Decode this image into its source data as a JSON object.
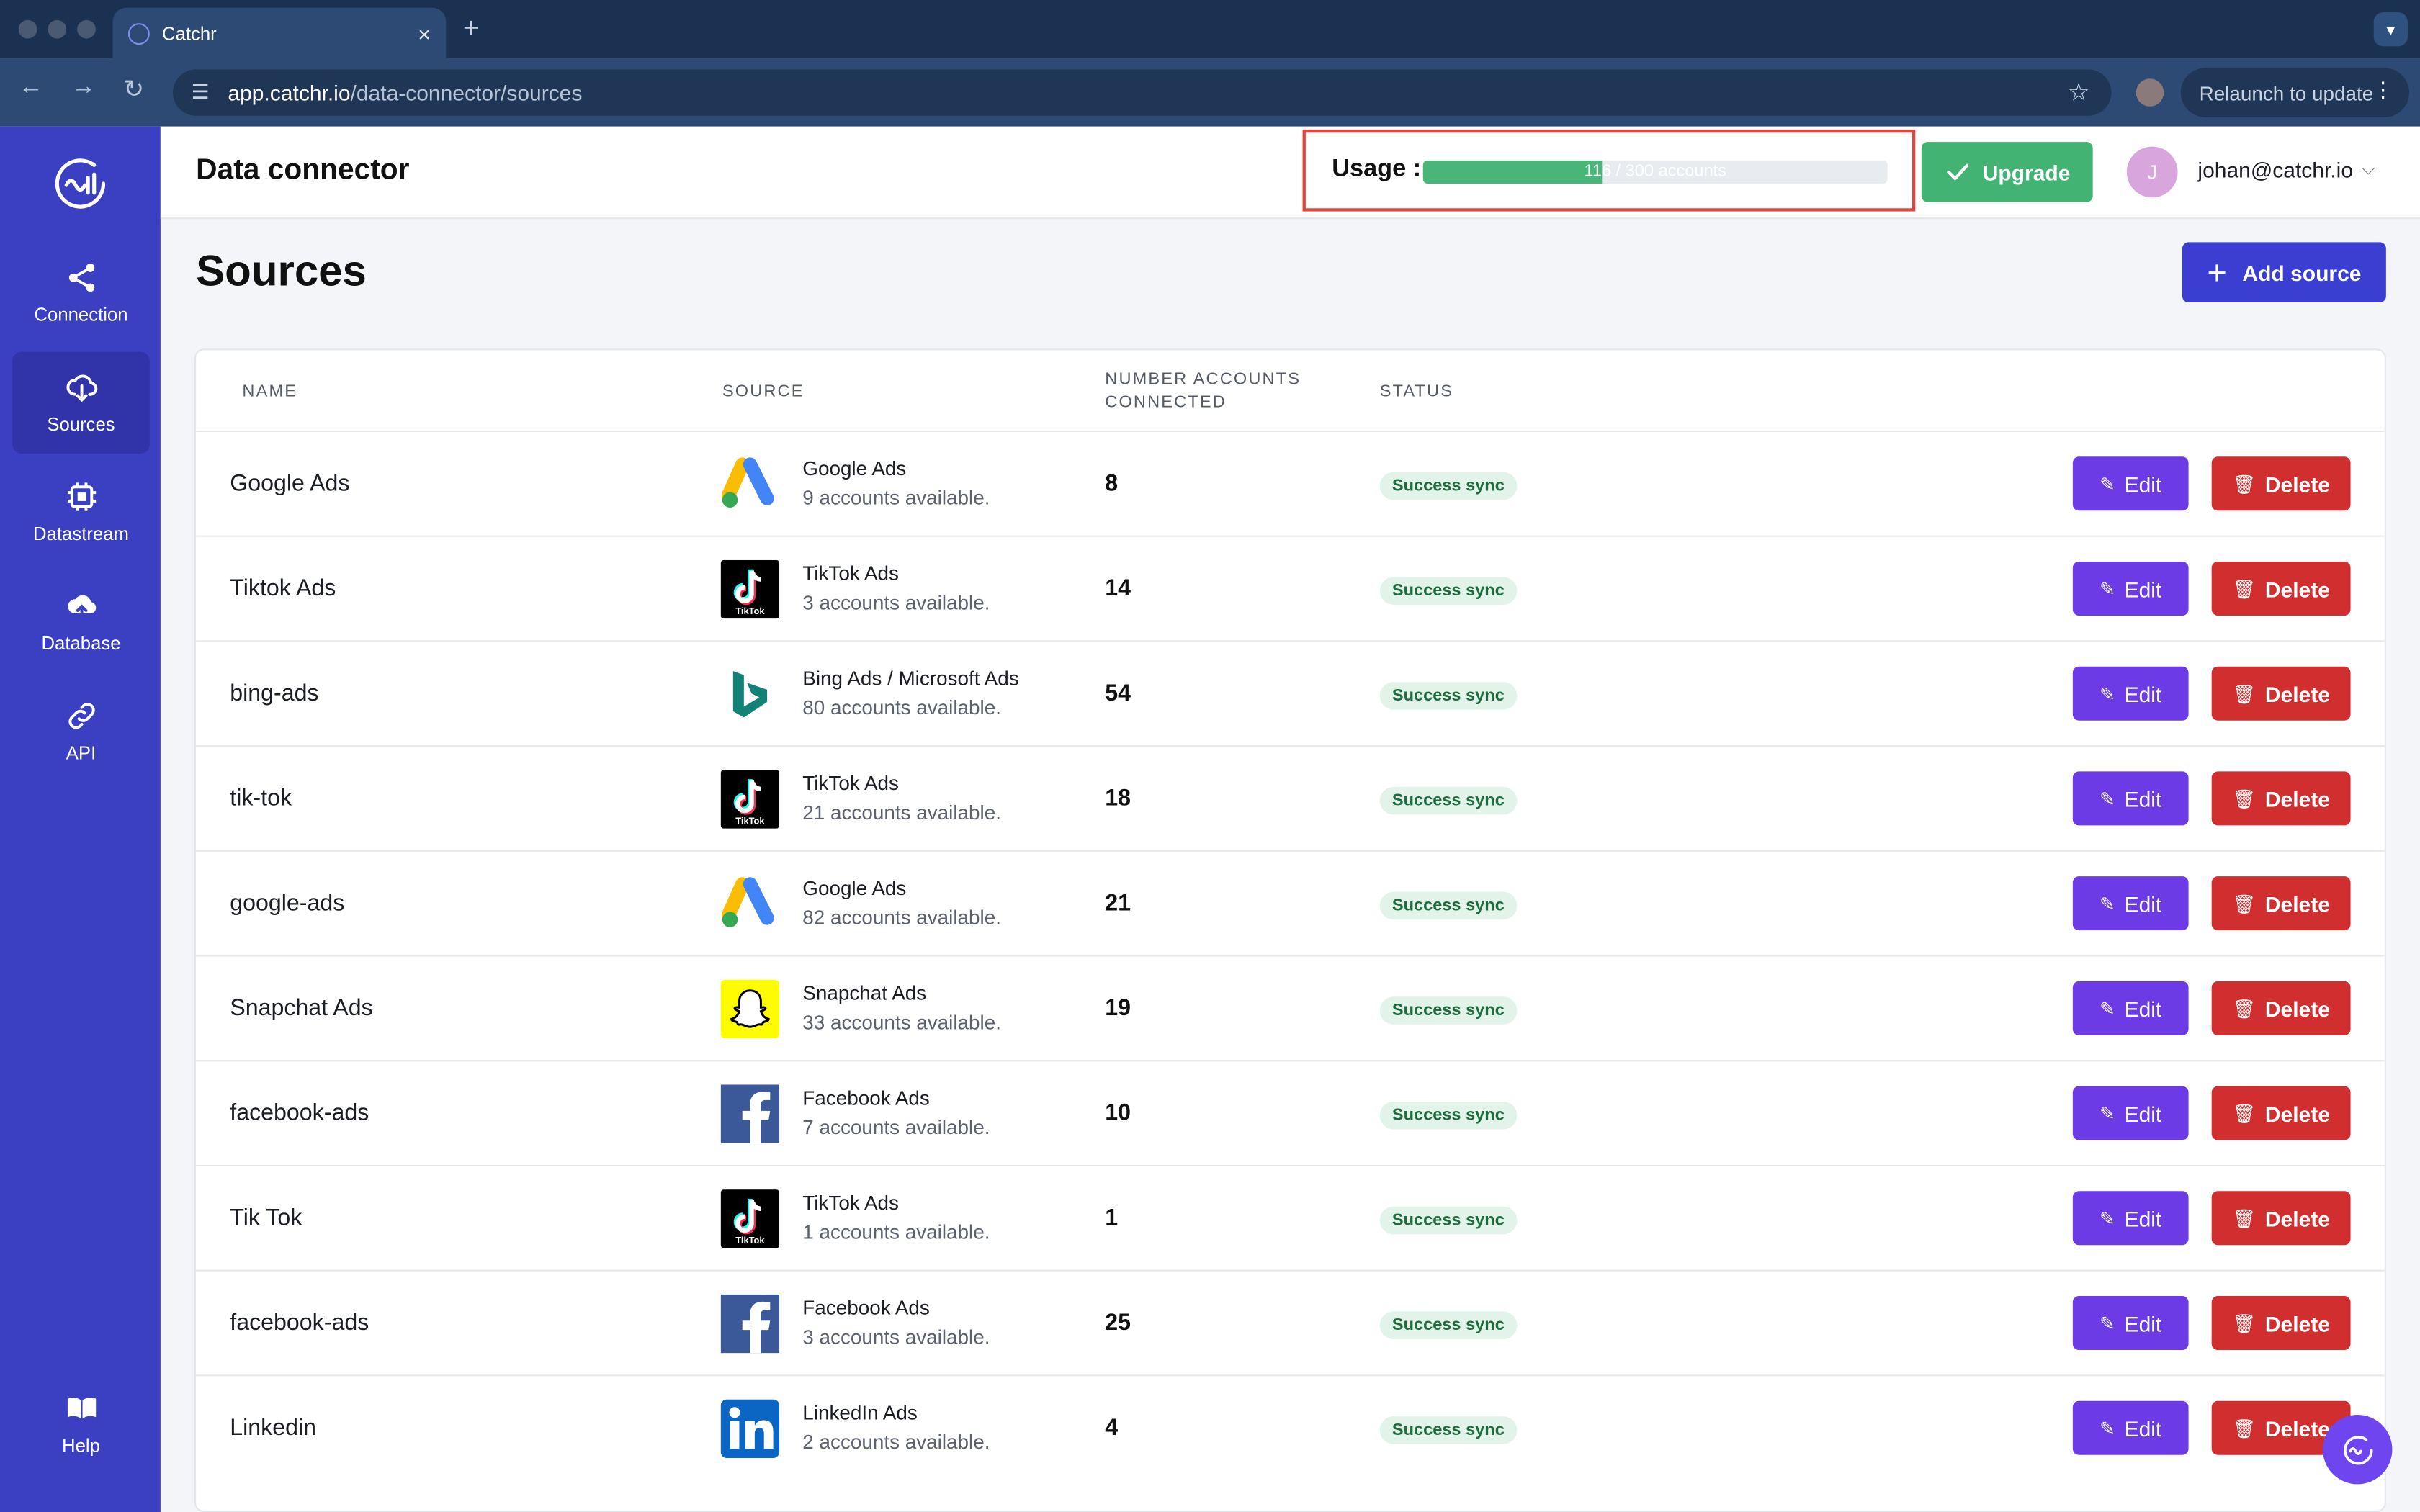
{
  "browser": {
    "tab_title": "Catchr",
    "tab_close": "×",
    "new_tab": "+",
    "url_host": "app.catchr.io",
    "url_path": "/data-connector/sources",
    "relaunch_label": "Relaunch to update"
  },
  "sidebar": {
    "items": [
      {
        "label": "Connection",
        "icon": "share-icon"
      },
      {
        "label": "Sources",
        "icon": "cloud-download-icon"
      },
      {
        "label": "Datastream",
        "icon": "chip-icon"
      },
      {
        "label": "Database",
        "icon": "cloud-upload-icon"
      },
      {
        "label": "API",
        "icon": "link-icon"
      }
    ],
    "help_label": "Help"
  },
  "header": {
    "title": "Data connector",
    "usage_label": "Usage :",
    "usage_text": "116 / 300 accounts",
    "usage_fraction": 0.387,
    "upgrade_label": "Upgrade",
    "avatar_initial": "J",
    "user_email": "johan@catchr.io"
  },
  "main": {
    "title": "Sources",
    "add_label": "Add source",
    "columns": {
      "name": "NAME",
      "source": "SOURCE",
      "accounts_line1": "NUMBER ACCOUNTS",
      "accounts_line2": "CONNECTED",
      "status": "STATUS"
    },
    "edit_label": "Edit",
    "delete_label": "Delete",
    "rows": [
      {
        "name": "Google Ads",
        "source": "Google Ads",
        "available": "9 accounts available.",
        "count": "8",
        "status": "Success sync",
        "icon": "google-ads"
      },
      {
        "name": "Tiktok Ads",
        "source": "TikTok Ads",
        "available": "3 accounts available.",
        "count": "14",
        "status": "Success sync",
        "icon": "tiktok"
      },
      {
        "name": "bing-ads",
        "source": "Bing Ads / Microsoft Ads",
        "available": "80 accounts available.",
        "count": "54",
        "status": "Success sync",
        "icon": "bing"
      },
      {
        "name": "tik-tok",
        "source": "TikTok Ads",
        "available": "21 accounts available.",
        "count": "18",
        "status": "Success sync",
        "icon": "tiktok"
      },
      {
        "name": "google-ads",
        "source": "Google Ads",
        "available": "82 accounts available.",
        "count": "21",
        "status": "Success sync",
        "icon": "google-ads"
      },
      {
        "name": "Snapchat Ads",
        "source": "Snapchat Ads",
        "available": "33 accounts available.",
        "count": "19",
        "status": "Success sync",
        "icon": "snapchat"
      },
      {
        "name": "facebook-ads",
        "source": "Facebook Ads",
        "available": "7 accounts available.",
        "count": "10",
        "status": "Success sync",
        "icon": "facebook"
      },
      {
        "name": "Tik Tok",
        "source": "TikTok Ads",
        "available": "1 accounts available.",
        "count": "1",
        "status": "Success sync",
        "icon": "tiktok"
      },
      {
        "name": "facebook-ads",
        "source": "Facebook Ads",
        "available": "3 accounts available.",
        "count": "25",
        "status": "Success sync",
        "icon": "facebook"
      },
      {
        "name": "Linkedin",
        "source": "LinkedIn Ads",
        "available": "2 accounts available.",
        "count": "4",
        "status": "Success sync",
        "icon": "linkedin"
      }
    ]
  },
  "tiktok_wordmark": "TikTok",
  "colors": {
    "sidebar": "#3b3fc1",
    "primary": "#3b3fd1",
    "edit": "#6d3be5",
    "delete": "#d12f2f",
    "success": "#43b374",
    "highlight": "#e0463b"
  }
}
